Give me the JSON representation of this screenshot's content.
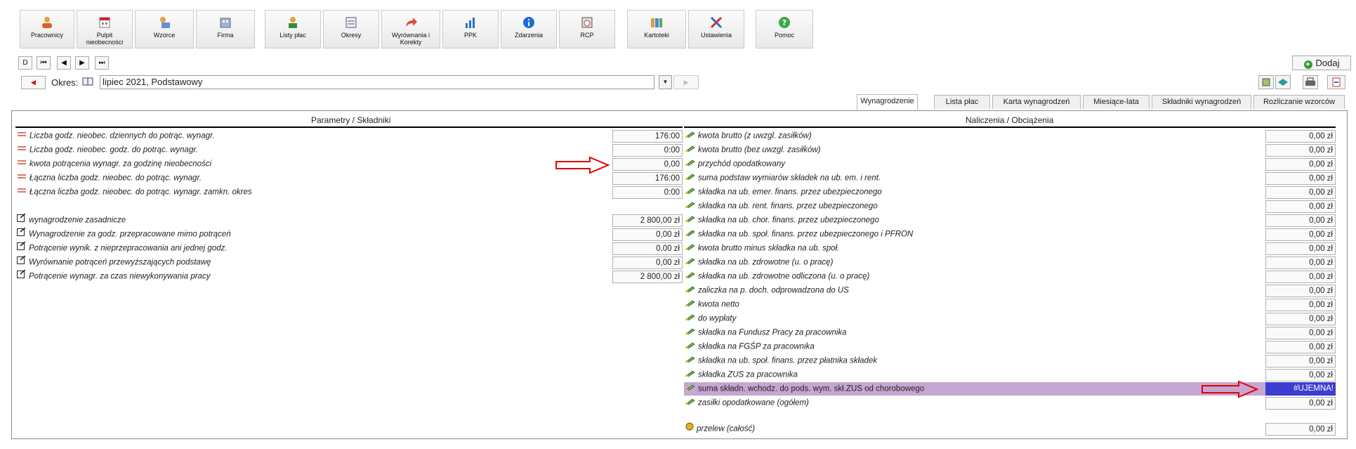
{
  "toolbar": {
    "buttons": [
      {
        "label": "Pracownicy",
        "icon": "users-icon"
      },
      {
        "label": "Pulpit nieobecności",
        "icon": "calendar-icon"
      },
      {
        "label": "Wzorce",
        "icon": "templates-icon"
      },
      {
        "label": "Firma",
        "icon": "company-icon"
      },
      {
        "label": "Listy płac",
        "icon": "payroll-icon"
      },
      {
        "label": "Okresy",
        "icon": "periods-icon"
      },
      {
        "label": "Wyrównania i Korekty",
        "icon": "corrections-icon"
      },
      {
        "label": "PPK",
        "icon": "chart-icon"
      },
      {
        "label": "Zdarzenia",
        "icon": "info-icon"
      },
      {
        "label": "RCP",
        "icon": "clock-icon"
      },
      {
        "label": "Kartoteki",
        "icon": "files-icon"
      },
      {
        "label": "Ustawienia",
        "icon": "tools-icon"
      },
      {
        "label": "Pomoc",
        "icon": "help-icon"
      }
    ]
  },
  "nav": {
    "buttons": [
      "D",
      "⏮",
      "◀",
      "▶",
      "⏭"
    ],
    "add_label": "Dodaj"
  },
  "okres": {
    "label": "Okres:",
    "value": "lipiec 2021, Podstawowy"
  },
  "tabs": [
    {
      "label": "Wynagrodzenie",
      "active": true
    },
    {
      "label": "Lista płac",
      "active": false
    },
    {
      "label": "Karta wynagrodzeń",
      "active": false
    },
    {
      "label": "Miesiące-lata",
      "active": false
    },
    {
      "label": "Składniki wynagrodzeń",
      "active": false
    },
    {
      "label": "Rozliczanie wzorców",
      "active": false
    }
  ],
  "left": {
    "header": "Parametry / Składniki",
    "rows": [
      {
        "label": "Liczba godz. nieobec. dziennych do potrąc. wynagr.",
        "value": "176:00",
        "icon": "param-icon"
      },
      {
        "label": "Liczba godz. nieobec. godz. do potrąc. wynagr.",
        "value": "0:00",
        "icon": "param-icon"
      },
      {
        "label": "kwota potrącenia wynagr. za godzinę nieobecności",
        "value": "0,00",
        "icon": "param-icon"
      },
      {
        "label": "Łączna liczba godz. nieobec. do potrąc. wynagr.",
        "value": "176:00",
        "icon": "param-icon"
      },
      {
        "label": "Łączna liczba godz. nieobec. do potrąc. wynagr. zamkn. okres",
        "value": "0:00",
        "icon": "param-icon"
      },
      {
        "label": "wynagrodzenie zasadnicze",
        "value": "2 800,00 zł",
        "icon": "component-icon"
      },
      {
        "label": "Wynagrodzenie za godz. przepracowane mimo potrąceń",
        "value": "0,00 zł",
        "icon": "component-icon"
      },
      {
        "label": "Potrącenie wynik. z nieprzepracowania ani jednej godz.",
        "value": "0,00 zł",
        "icon": "component-icon"
      },
      {
        "label": "Wyrównanie potrąceń przewyższających podstawę",
        "value": "0,00 zł",
        "icon": "component-icon"
      },
      {
        "label": "Potrącenie wynagr. za czas niewykonywania pracy",
        "value": "2 800,00 zł",
        "icon": "component-icon"
      }
    ]
  },
  "right": {
    "header": "Naliczenia / Obciążenia",
    "rows": [
      {
        "label": "kwota brutto (z uwzgl. zasiłków)",
        "value": "0,00 zł"
      },
      {
        "label": "kwota brutto (bez uwzgl. zasiłków)",
        "value": "0,00 zł"
      },
      {
        "label": "przychód opodatkowany",
        "value": "0,00 zł"
      },
      {
        "label": "suma podstaw wymiarów składek na ub. em. i rent.",
        "value": "0,00 zł"
      },
      {
        "label": "składka na ub. emer. finans. przez ubezpieczonego",
        "value": "0,00 zł"
      },
      {
        "label": "składka na ub. rent. finans. przez ubezpieczonego",
        "value": "0,00 zł"
      },
      {
        "label": "składka na ub. chor. finans. przez ubezpieczonego",
        "value": "0,00 zł"
      },
      {
        "label": "składka na ub. społ. finans. przez ubezpieczonego i PFRON",
        "value": "0,00 zł"
      },
      {
        "label": "kwota brutto minus składka na ub. społ.",
        "value": "0,00 zł"
      },
      {
        "label": "składka na ub. zdrowotne (u. o pracę)",
        "value": "0,00 zł"
      },
      {
        "label": "składka na ub. zdrowotne odliczona (u. o pracę)",
        "value": "0,00 zł"
      },
      {
        "label": "zaliczka na p. doch. odprowadzona do US",
        "value": "0,00 zł"
      },
      {
        "label": "kwota netto",
        "value": "0,00 zł"
      },
      {
        "label": "do wypłaty",
        "value": "0,00 zł"
      },
      {
        "label": "składka na Fundusz Pracy za pracownika",
        "value": "0,00 zł"
      },
      {
        "label": "składka na FGŚP za pracownika",
        "value": "0,00 zł"
      },
      {
        "label": "składka na ub. społ. finans. przez płatnika składek",
        "value": "0,00 zł"
      },
      {
        "label": "składka ZUS za pracownika",
        "value": "0,00 zł"
      },
      {
        "label": "suma składn. wchodz. do pods. wym. skł.ZUS od chorobowego",
        "value": "#UJEMNA!"
      },
      {
        "label": "zasiłki opodatkowane (ogółem)",
        "value": "0,00 zł"
      }
    ],
    "transfer": {
      "label": "przelew (całość)",
      "value": "0,00 zł"
    }
  },
  "colors": {
    "highlight_row": "#c6a6d2",
    "highlight_value": "#3d3dd1",
    "arrow": "#e00000"
  }
}
